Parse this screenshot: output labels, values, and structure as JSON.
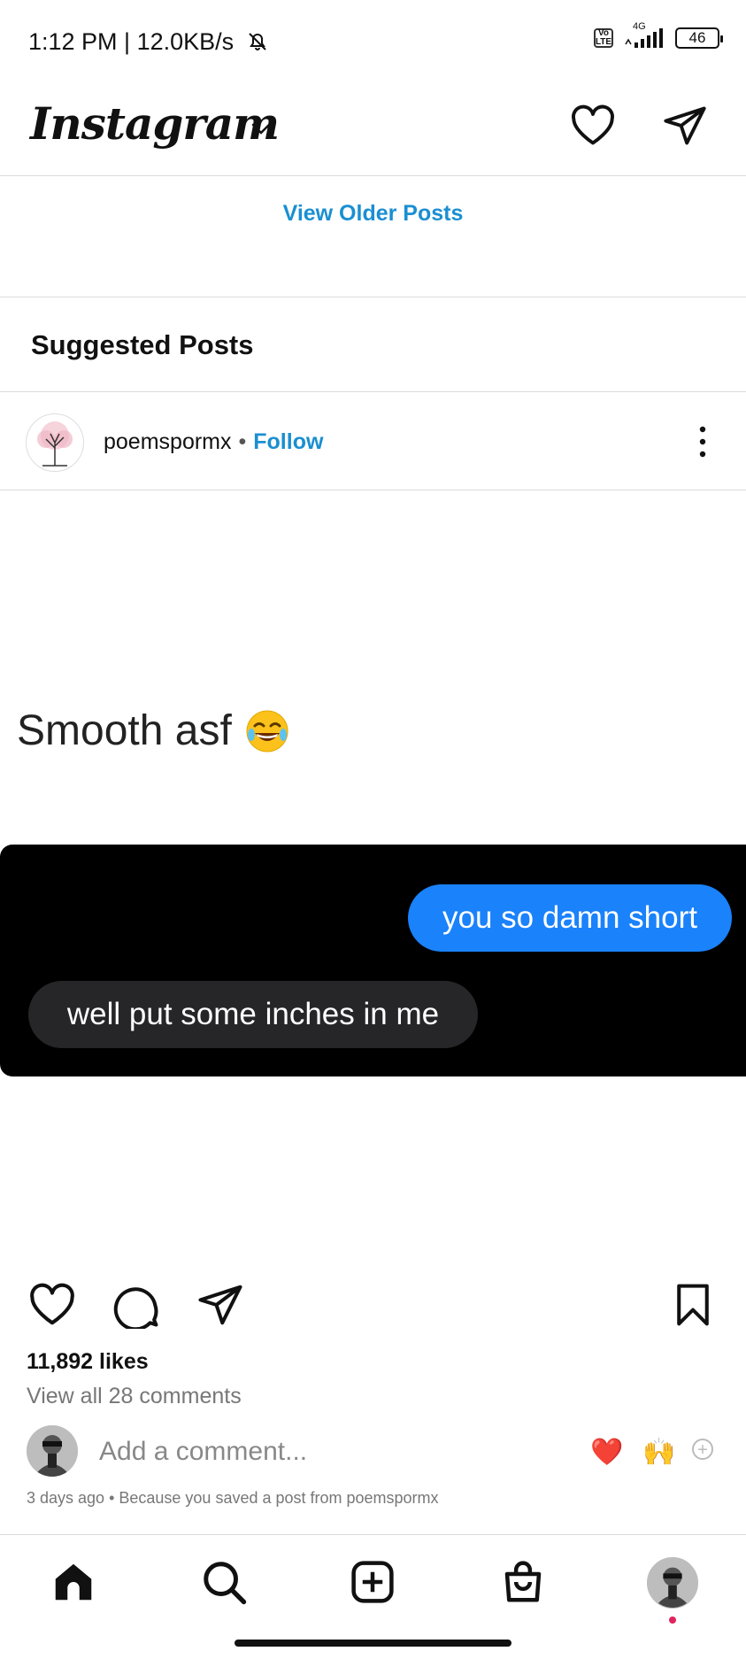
{
  "status_bar": {
    "time_speed": "1:12 PM | 12.0KB/s",
    "network_badge": "Vo LTE",
    "network_type": "4G",
    "battery": "46"
  },
  "app_bar": {
    "logo": "Instagram",
    "icons": [
      "chevron-down-icon",
      "heart-icon",
      "direct-send-icon"
    ]
  },
  "feed": {
    "view_older": "View Older Posts",
    "suggested_title": "Suggested Posts"
  },
  "post": {
    "username": "poemspormx",
    "separator": "•",
    "follow": "Follow",
    "caption": "Smooth asf",
    "caption_emoji": "😂",
    "messages": {
      "sent": "you so damn short",
      "received": "well put some inches in me"
    },
    "likes": "11,892 likes",
    "view_comments": "View all 28 comments",
    "add_comment_placeholder": "Add a comment...",
    "reactions": [
      "❤️",
      "🙌"
    ],
    "meta": "3 days ago • Because you saved a post from poemspormx"
  },
  "colors": {
    "link_blue": "#1a8fd1",
    "imessage_blue": "#1a82fb",
    "bubble_grey": "#262628"
  },
  "bottom_nav": {
    "icons": [
      "home-icon",
      "search-icon",
      "create-post-icon",
      "shop-icon",
      "profile-avatar"
    ]
  }
}
